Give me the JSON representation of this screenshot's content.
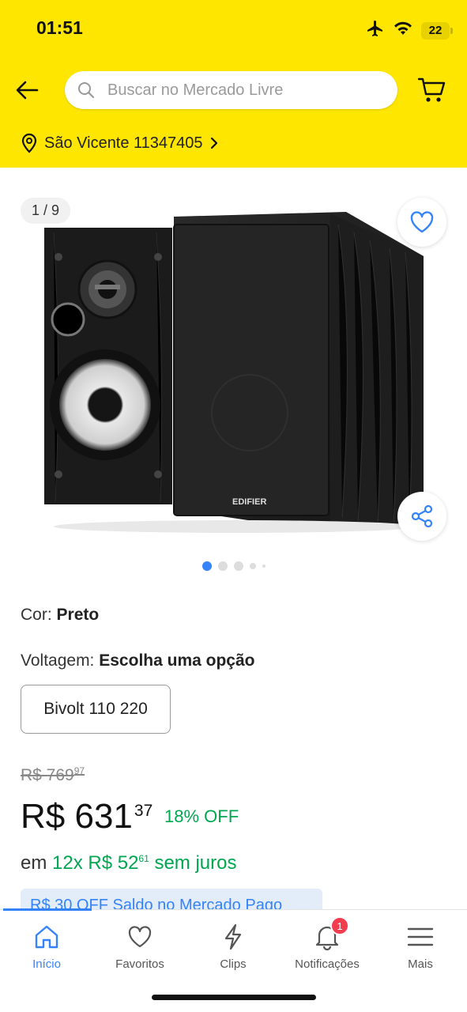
{
  "status_bar": {
    "time": "01:51",
    "battery": "22"
  },
  "header": {
    "search_placeholder": "Buscar no Mercado Livre",
    "location": "São Vicente 11347405",
    "accent_color": "#ffe600"
  },
  "gallery": {
    "counter": "1 / 9",
    "logo": "EDIFIER",
    "total_images": 9,
    "active_index": 0
  },
  "product": {
    "color_label": "Cor:",
    "color_value": "Preto",
    "voltage_label": "Voltagem:",
    "voltage_value": "Escolha uma opção",
    "voltage_option": "Bivolt 110 220",
    "old_price_int": "R$ 769",
    "old_price_cents": "97",
    "price_int": "R$ 631",
    "price_cents": "37",
    "discount": "18% OFF",
    "installments_prefix": "em",
    "installments_int": "12x R$ 52",
    "installments_cents": "61",
    "installments_suffix": "sem juros",
    "promo": "R$ 30 OFF Saldo no Mercado Pago"
  },
  "tabbar": {
    "items": [
      {
        "label": "Início",
        "icon": "home-icon",
        "active": true
      },
      {
        "label": "Favoritos",
        "icon": "heart-icon"
      },
      {
        "label": "Clips",
        "icon": "clips-icon"
      },
      {
        "label": "Notificações",
        "icon": "bell-icon",
        "badge": "1"
      },
      {
        "label": "Mais",
        "icon": "menu-icon"
      }
    ],
    "active_color": "#3483fa"
  }
}
